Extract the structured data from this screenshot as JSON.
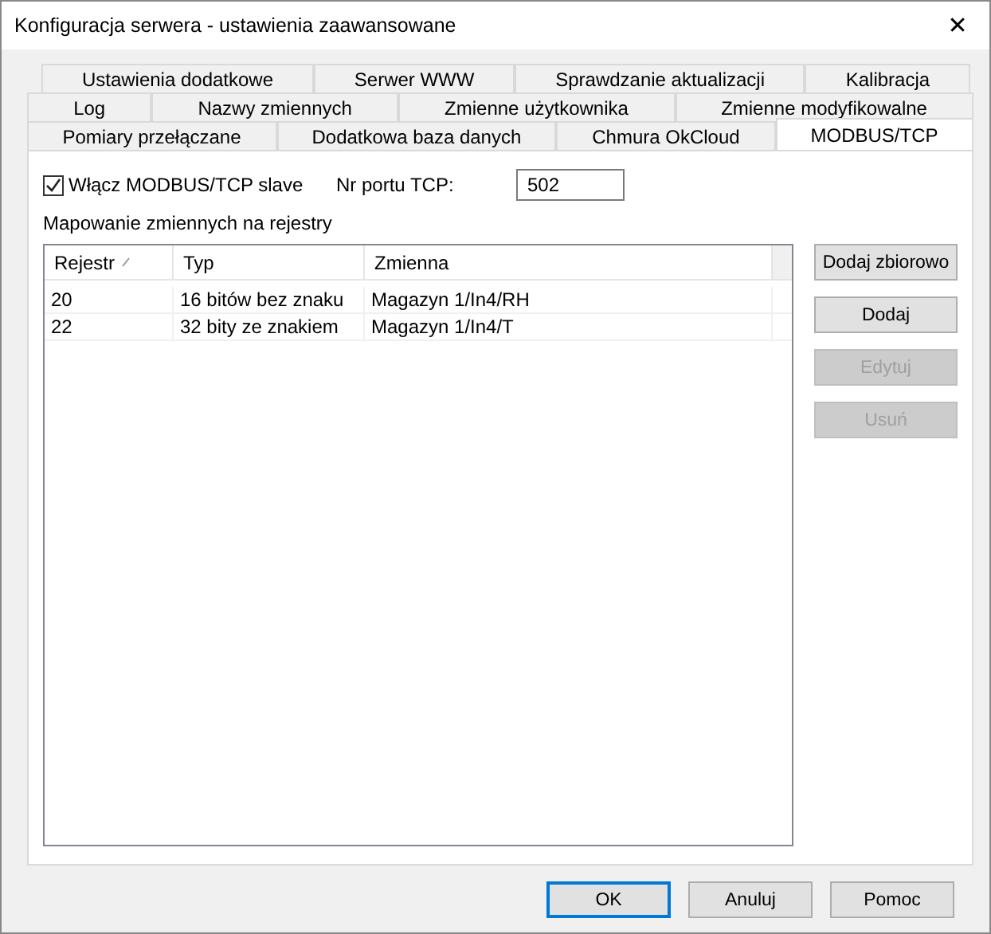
{
  "window": {
    "title": "Konfiguracja serwera - ustawienia zaawansowane",
    "close": "✕"
  },
  "tab_rows": [
    [
      {
        "label": "Ustawienia dodatkowe",
        "selected": false
      },
      {
        "label": "Serwer WWW",
        "selected": false
      },
      {
        "label": "Sprawdzanie aktualizacji",
        "selected": false
      },
      {
        "label": "Kalibracja",
        "selected": false
      }
    ],
    [
      {
        "label": "Log",
        "selected": false
      },
      {
        "label": "Nazwy zmiennych",
        "selected": false
      },
      {
        "label": "Zmienne użytkownika",
        "selected": false
      },
      {
        "label": "Zmienne modyfikowalne",
        "selected": false
      }
    ],
    [
      {
        "label": "Pomiary przełączane",
        "selected": false
      },
      {
        "label": "Dodatkowa baza danych",
        "selected": false
      },
      {
        "label": "Chmura OkCloud",
        "selected": false
      },
      {
        "label": "MODBUS/TCP",
        "selected": true
      }
    ]
  ],
  "enable": {
    "label": "Włącz MODBUS/TCP slave",
    "checked": true
  },
  "port": {
    "label": "Nr portu TCP:",
    "value": "502"
  },
  "mapping_label": "Mapowanie zmiennych na rejestry",
  "table": {
    "columns": [
      {
        "label": "Rejestr",
        "sorted": true
      },
      {
        "label": "Typ",
        "sorted": false
      },
      {
        "label": "Zmienna",
        "sorted": false
      }
    ],
    "rows": [
      [
        "20",
        "16 bitów bez znaku",
        "Magazyn 1/In4/RH"
      ],
      [
        "22",
        "32 bity ze znakiem",
        "Magazyn 1/In4/T"
      ]
    ]
  },
  "side_buttons": [
    {
      "label": "Dodaj zbiorowo",
      "disabled": false
    },
    {
      "label": "Dodaj",
      "disabled": false
    },
    {
      "label": "Edytuj",
      "disabled": true
    },
    {
      "label": "Usuń",
      "disabled": true
    }
  ],
  "footer_buttons": [
    {
      "label": "OK",
      "default": true
    },
    {
      "label": "Anuluj",
      "default": false
    },
    {
      "label": "Pomoc",
      "default": false
    }
  ]
}
